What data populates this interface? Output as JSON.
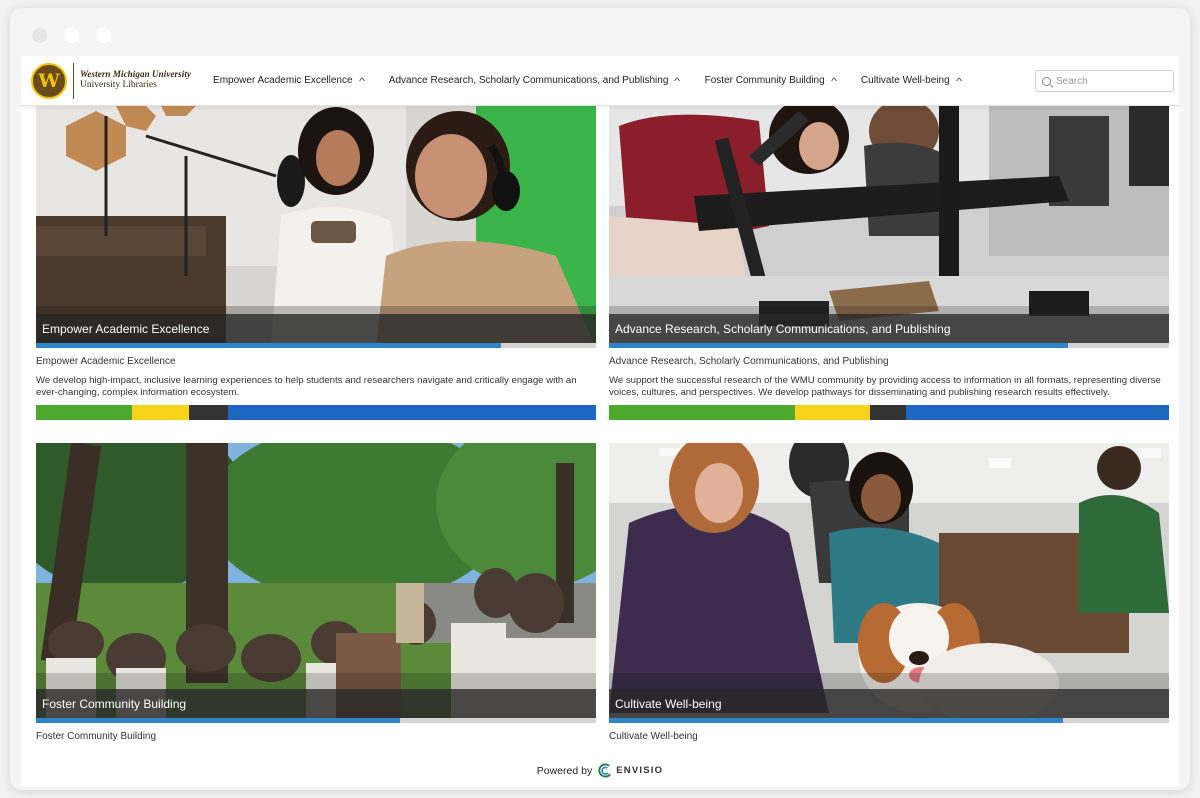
{
  "header": {
    "logo": {
      "mark": "W",
      "university": "Western Michigan University",
      "libraries": "University Libraries"
    },
    "nav": [
      {
        "label": "Empower Academic Excellence"
      },
      {
        "label": "Advance Research, Scholarly Communications, and Publishing"
      },
      {
        "label": "Foster Community Building"
      },
      {
        "label": "Cultivate Well-being"
      }
    ],
    "search": {
      "placeholder": "Search"
    }
  },
  "cards": [
    {
      "caption": "Empower Academic Excellence",
      "title": "Empower Academic Excellence",
      "description": "We develop high-impact, inclusive learning experiences to help students and researchers navigate and critically engage with an ever-changing, complex information ecosystem.",
      "progress": 0.83,
      "status_segments": [
        {
          "color": "#4caa2e",
          "fraction": 0.172
        },
        {
          "color": "#f7d31a",
          "fraction": 0.102
        },
        {
          "color": "#333333",
          "fraction": 0.068
        },
        {
          "color": "#1e67c0",
          "fraction": 0.658
        }
      ]
    },
    {
      "caption": "Advance Research, Scholarly Communications, and Publishing",
      "title": "Advance Research, Scholarly Communications, and Publishing",
      "description": "We support the successful research of the WMU community by providing access to information in all formats, representing diverse voices, cultures, and perspectives. We develop pathways for disseminating and publishing research results effectively.",
      "progress": 0.82,
      "status_segments": [
        {
          "color": "#4caa2e",
          "fraction": 0.333
        },
        {
          "color": "#f7d31a",
          "fraction": 0.133
        },
        {
          "color": "#333333",
          "fraction": 0.065
        },
        {
          "color": "#1e67c0",
          "fraction": 0.469
        }
      ]
    },
    {
      "caption": "Foster Community Building",
      "title": "Foster Community Building",
      "progress": 0.65
    },
    {
      "caption": "Cultivate Well-being",
      "title": "Cultivate Well-being",
      "progress": 0.81
    }
  ],
  "footer": {
    "powered_by": "Powered by",
    "brand": "ENVISIO"
  }
}
